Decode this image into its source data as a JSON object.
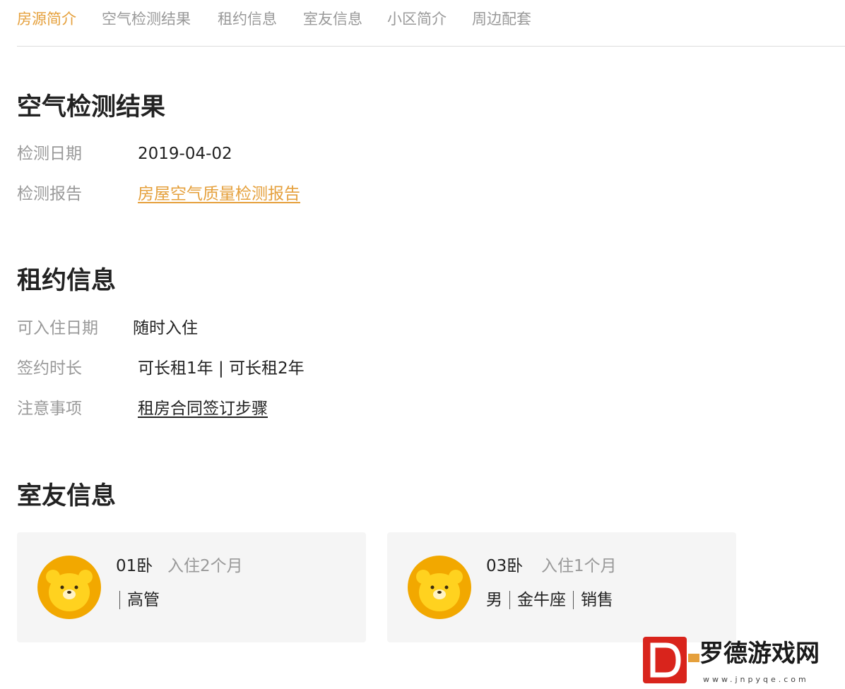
{
  "tabs": [
    {
      "label": "房源简介",
      "active": true
    },
    {
      "label": "空气检测结果",
      "active": false
    },
    {
      "label": "租约信息",
      "active": false
    },
    {
      "label": "室友信息",
      "active": false
    },
    {
      "label": "小区简介",
      "active": false
    },
    {
      "label": "周边配套",
      "active": false
    }
  ],
  "accent_color": "#e5a03c",
  "air_check": {
    "title": "空气检测结果",
    "date_label": "检测日期",
    "date_value": "2019-04-02",
    "report_label": "检测报告",
    "report_link": "房屋空气质量检测报告"
  },
  "lease": {
    "title": "租约信息",
    "movein_label": "可入住日期",
    "movein_value": "随时入住",
    "term_label": "签约时长",
    "term_value": "可长租1年 | 可长租2年",
    "notes_label": "注意事项",
    "notes_link": "租房合同签订步骤"
  },
  "roommates": {
    "title": "室友信息",
    "cards": [
      {
        "room": "01卧",
        "stay": "入住2个月",
        "tags": [
          "高管"
        ],
        "avatar_icon": "bear-avatar-icon"
      },
      {
        "room": "03卧",
        "stay": "入住1个月",
        "tags": [
          "男",
          "金牛座",
          "销售"
        ],
        "avatar_icon": "bear-avatar-icon"
      }
    ]
  },
  "watermark": {
    "text": "罗德游戏网",
    "url": "www.jnpyqe.com"
  }
}
